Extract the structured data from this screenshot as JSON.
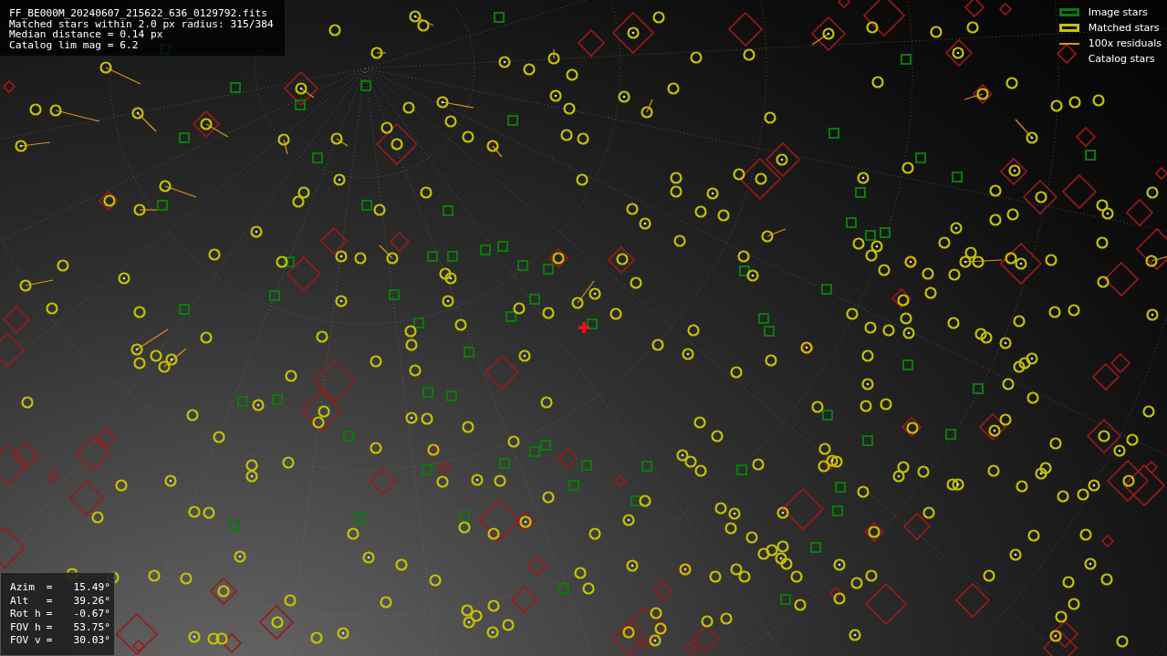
{
  "info_box": {
    "lines": [
      "FF_BE000M_20240607_215622_636_0129792.fits",
      "Matched stars within 2.0 px radius: 315/384",
      "Median distance = 0.14 px",
      "Catalog lim mag = 6.2"
    ]
  },
  "legend": [
    {
      "kind": "image",
      "label": "Image stars"
    },
    {
      "kind": "matched",
      "label": "Matched stars"
    },
    {
      "kind": "residual",
      "label": "100x residuals"
    },
    {
      "kind": "catalog",
      "label": "Catalog stars"
    }
  ],
  "pointing": [
    {
      "label": "Azim",
      "sign": "=",
      "value": "15.49°"
    },
    {
      "label": "Alt",
      "sign": "=",
      "value": "39.26°"
    },
    {
      "label": "Rot h",
      "sign": "=",
      "value": "-0.67°"
    },
    {
      "label": "FOV h",
      "sign": "=",
      "value": "53.75°"
    },
    {
      "label": "FOV v",
      "sign": "=",
      "value": "30.03°"
    }
  ]
}
